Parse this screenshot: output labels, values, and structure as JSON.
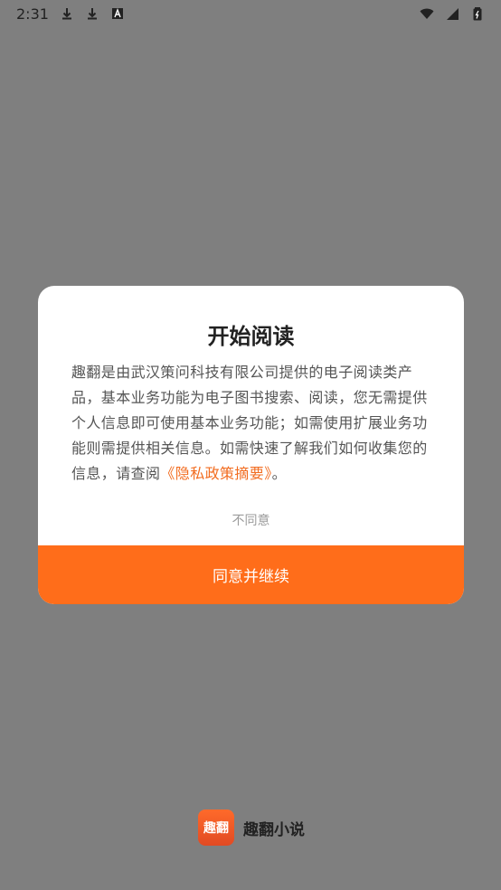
{
  "status_bar": {
    "time": "2:31",
    "icons_left": [
      "download-icon",
      "download-icon",
      "a-box-icon"
    ],
    "icons_right": [
      "wifi-icon",
      "cell-signal-icon",
      "battery-icon"
    ]
  },
  "dialog": {
    "title": "开始阅读",
    "body_prefix": "趣翻是由武汉策问科技有限公司提供的电子阅读类产品，基本业务功能为电子图书搜索、阅读，您无需提供个人信息即可使用基本业务功能；如需使用扩展业务功能则需提供相关信息。如需快速了解我们如何收集您的信息，请查阅",
    "policy_link": "《隐私政策摘要》",
    "body_suffix": "。",
    "disagree_label": "不同意",
    "agree_label": "同意并继续"
  },
  "brand": {
    "logo_text": "趣翻",
    "name": "趣翻小说"
  },
  "colors": {
    "overlay": "#7f7f7f",
    "accent": "#ff6d1a",
    "link": "#f26d21"
  }
}
